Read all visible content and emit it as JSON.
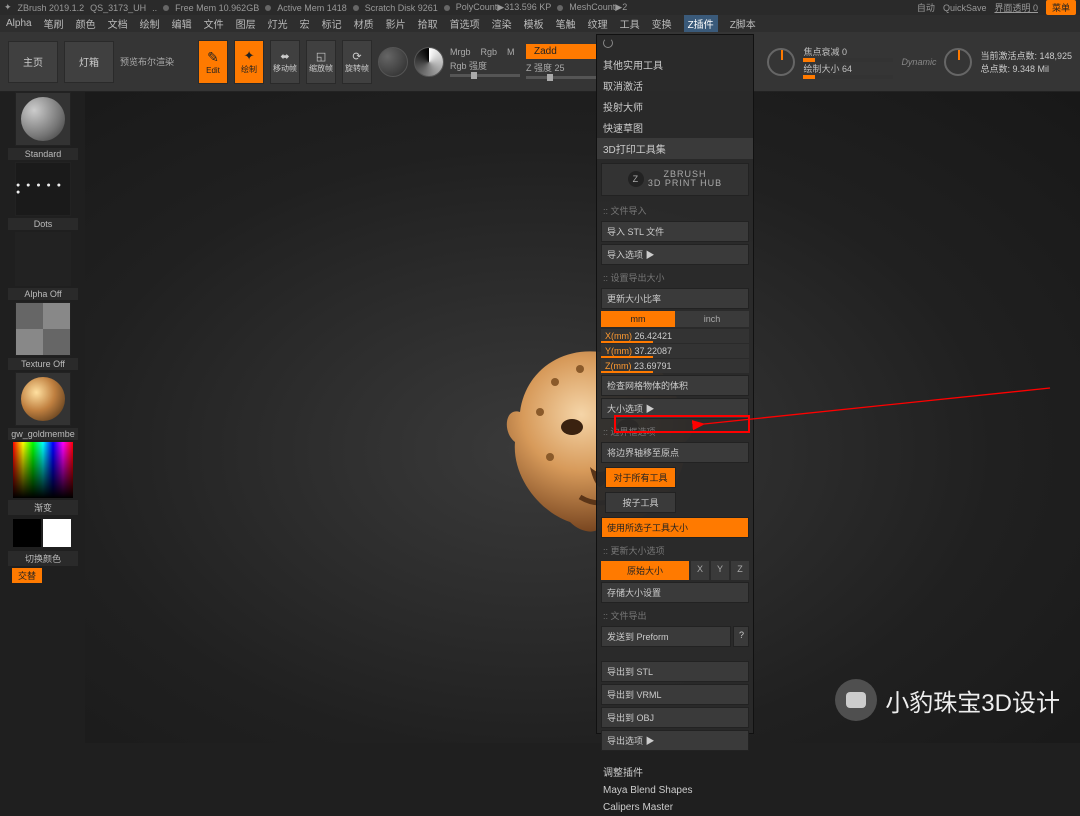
{
  "titlebar": {
    "app": "ZBrush 2019.1.2",
    "doc": "QS_3173_UH",
    "freemem": "Free Mem 10.962GB",
    "activemem": "Active Mem 1418",
    "scratch": "Scratch Disk 9261",
    "polycount": "PolyCount▶313.596 KP",
    "meshcount": "MeshCount▶2",
    "auto": "自动",
    "quicksave": "QuickSave",
    "transp": "界面透明 0",
    "menu": "菜单"
  },
  "menubar": [
    "Alpha",
    "笔刷",
    "颜色",
    "文档",
    "绘制",
    "编辑",
    "文件",
    "图层",
    "灯光",
    "宏",
    "标记",
    "材质",
    "影片",
    "拾取",
    "首选项",
    "渲染",
    "模板",
    "笔触",
    "纹理",
    "工具",
    "变换",
    "Z插件",
    "Z脚本"
  ],
  "menubar_active_index": 21,
  "toolbar": {
    "home": "主页",
    "lightbox": "灯箱",
    "preview": "预览布尔渲染",
    "edit": "Edit",
    "draw": "绘制",
    "move": "移动帧",
    "scale": "缩放帧",
    "rotate": "旋转帧",
    "mrgb": "Mrgb",
    "rgb": "Rgb",
    "m": "M",
    "rgbint": "Rgb 强度",
    "zadd": "Zadd",
    "zstrength": "Z 强度 25",
    "focal": "焦点衰减 0",
    "drawsize": "绘制大小 64",
    "dynamic": "Dynamic",
    "activepts": "当前激活点数: 148,925",
    "totalpts": "总点数: 9.348 Mil"
  },
  "leftbar": {
    "brush": "Standard",
    "stroke": "Dots",
    "alpha": "Alpha Off",
    "texture": "Texture Off",
    "material": "gw_goldmembe",
    "gradient": "渐变",
    "switchcolor": "切换颜色",
    "alternate": "交替"
  },
  "panel": {
    "top": [
      "其他实用工具",
      "取消激活",
      "投射大师",
      "快速草图",
      "3D打印工具集"
    ],
    "logo": "ZBRUSH\n3D PRINT HUB",
    "sec_import_hdr": ":: 文件导入",
    "import_stl": "导入 STL 文件",
    "import_opts": "导入选项 ▶",
    "sec_size_hdr": ":: 设置导出大小",
    "update_ratio": "更新大小比率",
    "unit_mm": "mm",
    "unit_inch": "inch",
    "dims": [
      {
        "axis": "X(mm)",
        "val": "26.42421"
      },
      {
        "axis": "Y(mm)",
        "val": "37.22087"
      },
      {
        "axis": "Z(mm)",
        "val": "23.69791"
      }
    ],
    "check_volume": "检查网格物体的体积",
    "size_opts": "大小选项 ▶",
    "sec_bbox_hdr": ":: 边界框选项",
    "move_origin": "将边界轴移至原点",
    "all_tools": "对于所有工具",
    "by_tool": "按子工具",
    "use_subtool_size": "使用所选子工具大小",
    "sec_update_size_hdr": ":: 更新大小选项",
    "orig_size": "原始大小",
    "axes": [
      "X",
      "Y",
      "Z"
    ],
    "save_size": "存储大小设置",
    "sec_export_hdr": ":: 文件导出",
    "send_preform": "发送到 Preform",
    "export_stl": "导出到 STL",
    "export_vrml": "导出到 VRML",
    "export_obj": "导出到 OBJ",
    "export_opts": "导出选项 ▶",
    "bottom": [
      "调整插件",
      "Maya Blend Shapes",
      "Calipers Master"
    ]
  },
  "watermark": "小豹珠宝3D设计"
}
